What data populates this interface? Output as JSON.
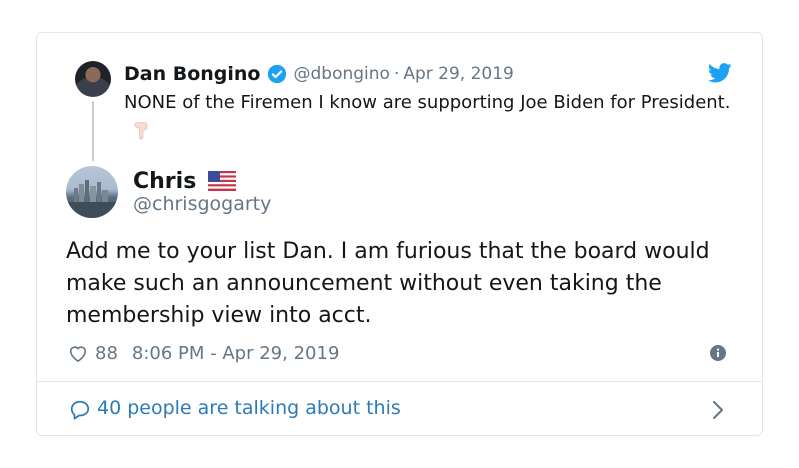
{
  "parent_tweet": {
    "name": "Dan Bongino",
    "handle": "@dbongino",
    "separator": "·",
    "date": "Apr 29, 2019",
    "text": "NONE of the Firemen I know are supporting Joe Biden for President."
  },
  "tweet": {
    "name": "Chris",
    "handle": "@chrisgogarty",
    "text": "Add me to your list Dan. I am furious that the board would make such an announcement without even taking the membership view into acct.",
    "likes": "88",
    "timestamp": "8:06 PM - Apr 29, 2019"
  },
  "footer": {
    "talking_label": "40 people are talking about this"
  },
  "icons": {
    "verified": "verified-badge-icon",
    "bird": "twitter-bird-icon",
    "pointing": "backhand-pointing-down-icon",
    "flag": "us-flag-icon",
    "heart": "heart-icon",
    "info": "info-icon",
    "bubble": "speech-bubble-icon",
    "chevron": "chevron-right-icon"
  },
  "colors": {
    "link_blue": "#2b7bb9",
    "twitter_blue": "#1da1f2",
    "muted_text": "#657786",
    "border": "#e1e8ed"
  }
}
